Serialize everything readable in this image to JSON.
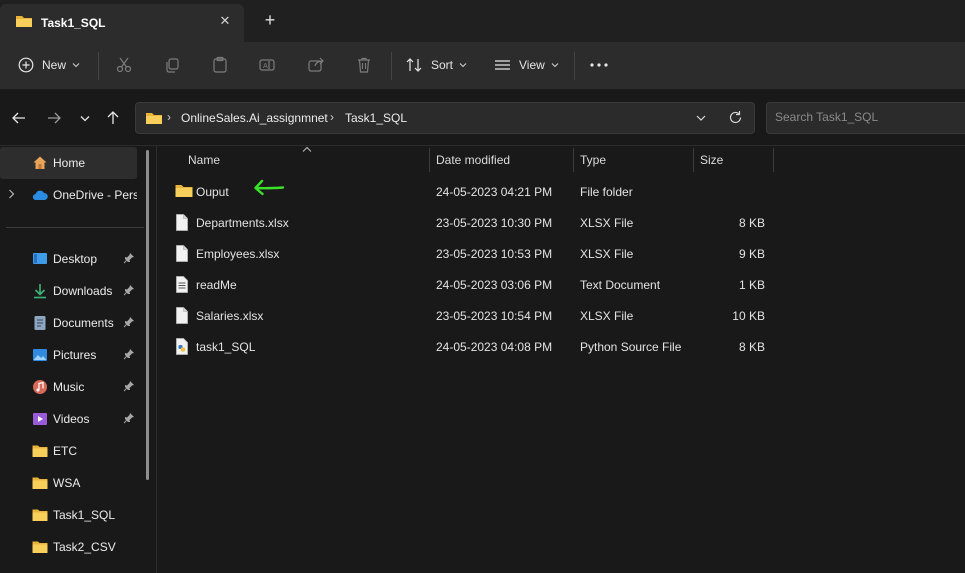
{
  "tab": {
    "title": "Task1_SQL"
  },
  "toolbar": {
    "new_label": "New",
    "sort_label": "Sort",
    "view_label": "View"
  },
  "address": {
    "crumbs": [
      "OnlineSales.Ai_assignmnet",
      "Task1_SQL"
    ]
  },
  "search": {
    "placeholder": "Search Task1_SQL"
  },
  "sidebar": {
    "home": "Home",
    "onedrive": "OneDrive - Perso",
    "items": [
      {
        "label": "Desktop",
        "icon": "desktop-icon",
        "pinned": true
      },
      {
        "label": "Downloads",
        "icon": "download-icon",
        "pinned": true
      },
      {
        "label": "Documents",
        "icon": "documents-icon",
        "pinned": true
      },
      {
        "label": "Pictures",
        "icon": "pictures-icon",
        "pinned": true
      },
      {
        "label": "Music",
        "icon": "music-icon",
        "pinned": true
      },
      {
        "label": "Videos",
        "icon": "videos-icon",
        "pinned": true
      },
      {
        "label": "ETC",
        "icon": "folder-icon",
        "pinned": false
      },
      {
        "label": "WSA",
        "icon": "folder-icon",
        "pinned": false
      },
      {
        "label": "Task1_SQL",
        "icon": "folder-icon",
        "pinned": false
      },
      {
        "label": "Task2_CSV",
        "icon": "folder-icon",
        "pinned": false
      }
    ]
  },
  "columns": {
    "name": "Name",
    "date": "Date modified",
    "type": "Type",
    "size": "Size"
  },
  "files": [
    {
      "name": "Ouput",
      "date": "24-05-2023 04:21 PM",
      "type": "File folder",
      "size": "",
      "icon": "folder-icon"
    },
    {
      "name": "Departments.xlsx",
      "date": "23-05-2023 10:30 PM",
      "type": "XLSX File",
      "size": "8 KB",
      "icon": "file-icon"
    },
    {
      "name": "Employees.xlsx",
      "date": "23-05-2023 10:53 PM",
      "type": "XLSX File",
      "size": "9 KB",
      "icon": "file-icon"
    },
    {
      "name": "readMe",
      "date": "24-05-2023 03:06 PM",
      "type": "Text Document",
      "size": "1 KB",
      "icon": "text-file-icon"
    },
    {
      "name": "Salaries.xlsx",
      "date": "23-05-2023 10:54 PM",
      "type": "XLSX File",
      "size": "10 KB",
      "icon": "file-icon"
    },
    {
      "name": "task1_SQL",
      "date": "24-05-2023 04:08 PM",
      "type": "Python Source File",
      "size": "8 KB",
      "icon": "python-file-icon"
    }
  ],
  "colors": {
    "folder": "#f3c94b",
    "annotation": "#3be02b",
    "background": "#191919",
    "toolbar": "#2c2c2c"
  }
}
